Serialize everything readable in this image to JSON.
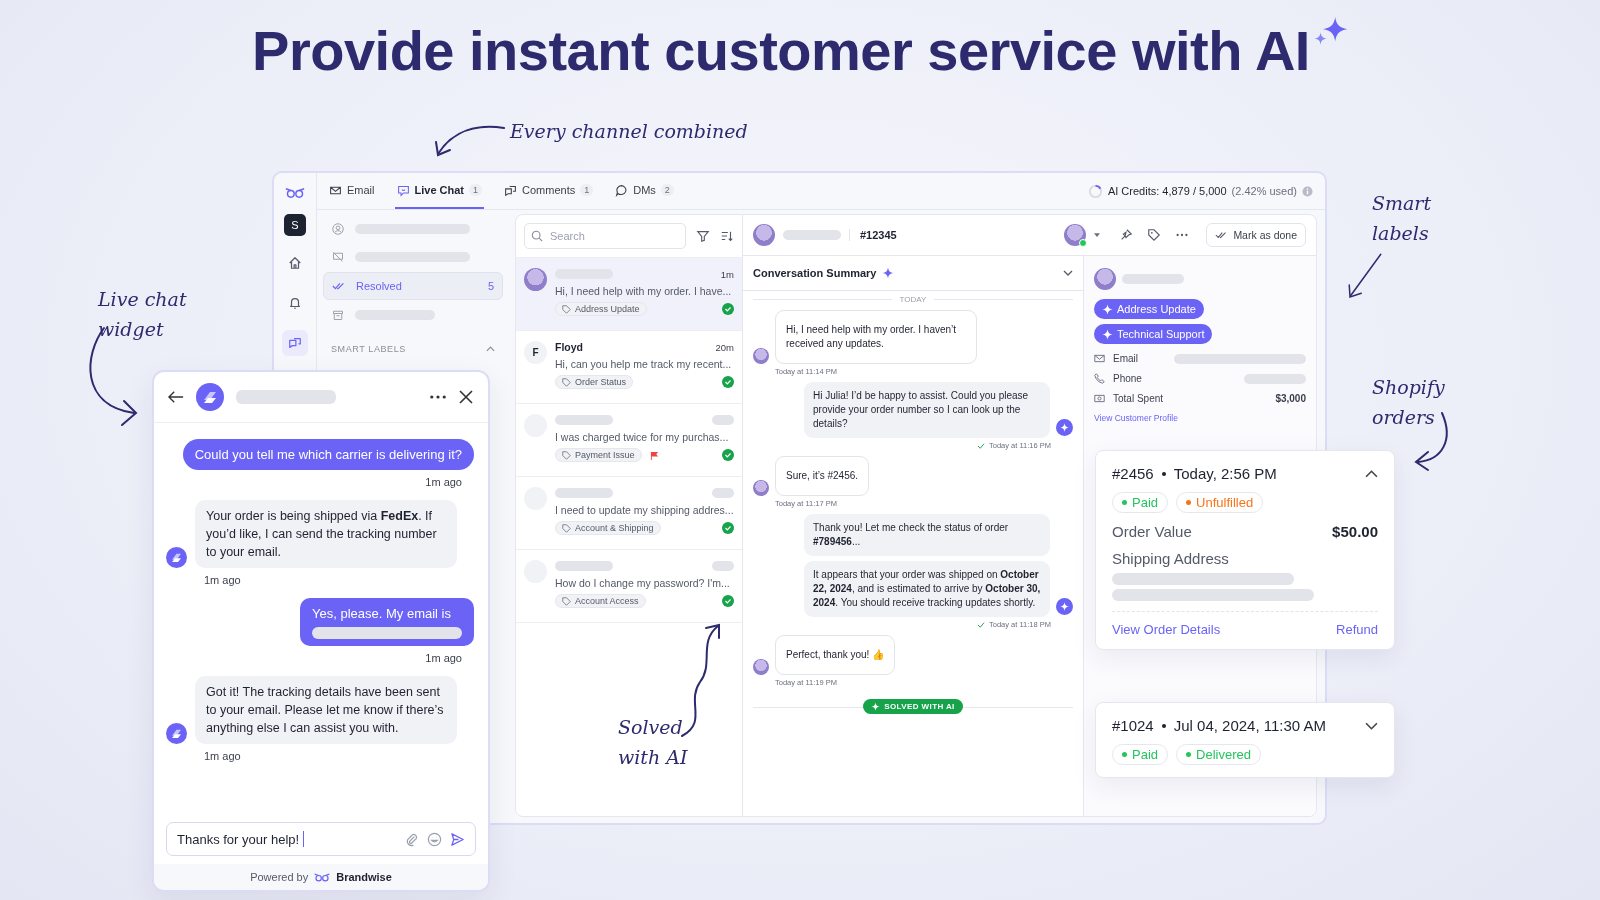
{
  "headline": {
    "text": "Provide instant customer service with AI"
  },
  "annotations": [
    "Every channel combined",
    "Live chat widget",
    "Smart labels",
    "Shopify orders",
    "Solved with AI"
  ],
  "app": {
    "rail": {
      "avatar": "S",
      "items": [
        {
          "selected": false
        },
        {
          "selected": false
        },
        {
          "selected": true
        }
      ]
    },
    "tabs": [
      {
        "label": "Email",
        "selected": false
      },
      {
        "label": "Live Chat",
        "count": "1",
        "selected": true
      },
      {
        "label": "Comments",
        "count": "1",
        "selected": false
      },
      {
        "label": "DMs",
        "count": "2",
        "selected": false
      }
    ],
    "ai_credits": {
      "label": "AI Credits: 4,879 / 5,000",
      "usage": "(2.42% used)"
    },
    "nav": {
      "items": [
        {
          "kind": "skeleton",
          "selected": false
        },
        {
          "kind": "skeleton",
          "selected": false
        },
        {
          "kind": "item",
          "label": "Resolved",
          "count": "5",
          "selected": true
        },
        {
          "kind": "skeleton",
          "selected": false
        }
      ],
      "section": "SMART LABELS",
      "section_expanded": true
    },
    "search": {
      "placeholder": "Search"
    },
    "conversations": [
      {
        "kind": "photo",
        "time": "1m",
        "preview": "Hi, I need help with my order. I have...",
        "label": "Address Update",
        "flagged": false,
        "resolved": true,
        "selected": true
      },
      {
        "kind": "initial",
        "initial": "F",
        "name": "Floyd",
        "time": "20m",
        "preview": "Hi, can you help me track my recent...",
        "label": "Order Status",
        "flagged": false,
        "resolved": true,
        "selected": false
      },
      {
        "kind": "blank",
        "preview": "I was charged twice for my purchas...",
        "label": "Payment Issue",
        "flagged": true,
        "resolved": true,
        "selected": false
      },
      {
        "kind": "blank",
        "preview": "I need to update my shipping addres...",
        "label": "Account & Shipping",
        "flagged": false,
        "resolved": true,
        "selected": false
      },
      {
        "kind": "blank",
        "preview": "How do I change my password? I'm...",
        "label": "Account Access",
        "flagged": false,
        "resolved": true,
        "selected": false
      }
    ],
    "chat_header": {
      "ticket": "#12345",
      "button": "Mark as done"
    },
    "summary": {
      "title": "Conversation Summary"
    },
    "day_divider": "TODAY",
    "messages": [
      {
        "kind": "customer",
        "bubbles": [
          "Hi, I need help with my order. I haven’t received any updates."
        ],
        "time": "Today at 11:14 PM"
      },
      {
        "kind": "agent",
        "bubbles": [
          "Hi Julia! I’d be happy to assist. Could you please provide your order number so I can look up the details?"
        ],
        "time": "Today at 11:16 PM",
        "read": true
      },
      {
        "kind": "customer",
        "bubbles": [
          "Sure, it’s #2456."
        ],
        "time": "Today at 11:17 PM"
      },
      {
        "kind": "agent",
        "bubbles": [
          "Thank you! Let me check the status of order **#789456**...",
          "It appears that your order was shipped on **October 22, 2024**, and is estimated to arrive by **October 30, 2024**. You should receive tracking updates shortly."
        ],
        "time": "Today at 11:18 PM",
        "read": true
      },
      {
        "kind": "customer",
        "bubbles": [
          "Perfect, thank you! 👍"
        ],
        "time": "Today at 11:19 PM"
      }
    ],
    "status_banner": "SOLVED WITH AI",
    "customer": {
      "labels": [
        "Address Update",
        "Technical Support"
      ],
      "fields": [
        {
          "label": "Email"
        },
        {
          "label": "Phone"
        },
        {
          "label": "Total Spent",
          "value": "$3,000"
        }
      ],
      "profile_link": "View Customer Profile"
    }
  },
  "orders": [
    {
      "number": "#2456",
      "date": "Today, 2:56 PM",
      "expanded": true,
      "badges": [
        {
          "text": "Paid",
          "color": "#22c55e"
        },
        {
          "text": "Unfulfilled",
          "color": "#f97316"
        }
      ],
      "value_label": "Order Value",
      "value": "$50.00",
      "address_label": "Shipping Address",
      "links": [
        "View Order Details",
        "Refund"
      ]
    },
    {
      "number": "#1024",
      "date": "Jul 04, 2024, 11:30 AM",
      "expanded": false,
      "badges": [
        {
          "text": "Paid",
          "color": "#22c55e"
        },
        {
          "text": "Delivered",
          "color": "#22c55e"
        }
      ]
    }
  ],
  "widget": {
    "messages": [
      {
        "kind": "user",
        "text": "Could you tell me which carrier is delivering it?",
        "time": "1m ago"
      },
      {
        "kind": "bot",
        "text": "Your order is being shipped via **FedEx**. If you’d like, I can send the tracking number to your email.",
        "time": "1m ago"
      },
      {
        "kind": "user",
        "text": "Yes, please. My email is",
        "redacted": true,
        "time": "1m ago"
      },
      {
        "kind": "bot",
        "text": "Got it! The tracking details have been sent to your email. Please let me know if there’s anything else I can assist you with.",
        "time": "1m ago"
      }
    ],
    "input_value": "Thanks for your help!",
    "powered_by": "Powered by",
    "brand": "Brandwise"
  }
}
